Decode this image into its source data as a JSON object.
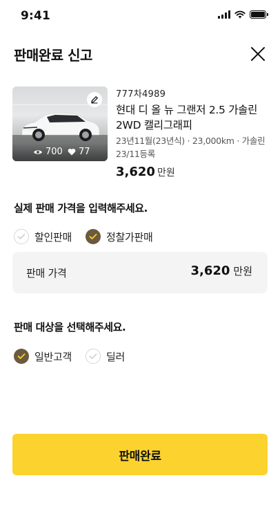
{
  "status_bar": {
    "time": "9:41"
  },
  "header": {
    "title": "판매완료 신고"
  },
  "car": {
    "plate": "777차4989",
    "name": "현대 디 올 뉴 그랜저 2.5 가솔린 2WD 캘리그래피",
    "meta": "23년11월(23년식) · 23,000km · 가솔린 23/11등록",
    "price_number": "3,620",
    "price_unit": "만원",
    "views": "700",
    "likes": "77"
  },
  "price_section": {
    "title": "실제 판매 가격을 입력해주세요.",
    "options": [
      {
        "label": "할인판매",
        "selected": false
      },
      {
        "label": "정찰가판매",
        "selected": true
      }
    ],
    "input_label": "판매 가격",
    "input_value": "3,620",
    "input_unit": "만원"
  },
  "target_section": {
    "title": "판매 대상을 선택해주세요.",
    "options": [
      {
        "label": "일반고객",
        "selected": true
      },
      {
        "label": "딜러",
        "selected": false
      }
    ]
  },
  "submit": {
    "label": "판매완료"
  },
  "colors": {
    "accent": "#fcd32e",
    "radio_selected": "#6b5a3e",
    "input_bg": "#f4f4f4"
  }
}
